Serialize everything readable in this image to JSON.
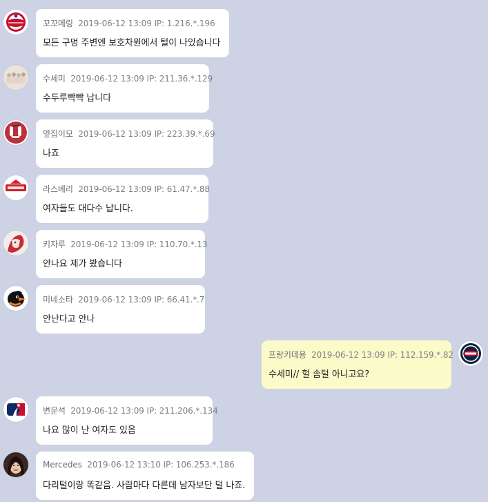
{
  "messages": [
    {
      "author": "꼬꼬메링",
      "time": "2019-06-12 13:09",
      "ip": "IP: 1.216.*.196",
      "text": "모든 구멍 주변엔 보호차원에서 털이 나있습니다",
      "avatar": "phillies-logo-icon",
      "mine": false
    },
    {
      "author": "수세미",
      "time": "2019-06-12 13:09",
      "ip": "IP: 211.36.*.129",
      "text": "수두루빡빡 납니다",
      "avatar": "group-photo-icon",
      "mine": false
    },
    {
      "author": "옆집이모",
      "time": "2019-06-12 13:09",
      "ip": "IP: 223.39.*.69",
      "text": "나죠",
      "avatar": "red-sox-logo-icon",
      "mine": false
    },
    {
      "author": "라스베리",
      "time": "2019-06-12 13:09",
      "ip": "IP: 61.47.*.88",
      "text": "여자들도 대다수 납니다.",
      "avatar": "lanciers-logo-icon",
      "mine": false
    },
    {
      "author": "키자루",
      "time": "2019-06-12 13:09",
      "ip": "IP: 110.70.*.13",
      "text": "안나요 제가 봤습니다",
      "avatar": "character-avatar-icon",
      "mine": false
    },
    {
      "author": "미네소타",
      "time": "2019-06-12 13:09",
      "ip": "IP: 66.41.*.7",
      "text": "안난다고 안나",
      "avatar": "orioles-bird-icon",
      "mine": false
    },
    {
      "author": "프랑키데용",
      "time": "2019-06-12 13:09",
      "ip": "IP: 112.159.*.82",
      "text": "수세미// 헐 솜털 아니고요?",
      "avatar": "twins-logo-icon",
      "mine": true
    },
    {
      "author": "변문석",
      "time": "2019-06-12 13:09",
      "ip": "IP: 211.206.*.134",
      "text": "나요 많이 난 여자도 있음",
      "avatar": "mlb-logo-icon",
      "mine": false
    },
    {
      "author": "Mercedes",
      "time": "2019-06-12 13:10",
      "ip": "IP: 106.253.*.186",
      "text": "다리털이랑 똑같음. 사람마다 다른데 남자보단 덜 나죠.",
      "avatar": "woman-photo-icon",
      "mine": false
    }
  ],
  "colors": {
    "background": "#cdd3e4",
    "bubble": "#ffffff",
    "my_bubble": "#fbfac9",
    "meta_text": "#7b7f87",
    "body_text": "#222222"
  }
}
